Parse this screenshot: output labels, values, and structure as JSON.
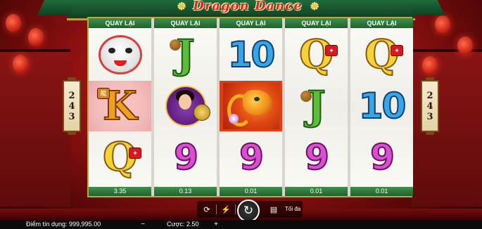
{
  "game": {
    "title": "Dragon Dance"
  },
  "ways": {
    "left": [
      "2",
      "4",
      "3"
    ],
    "right": [
      "2",
      "4",
      "3"
    ]
  },
  "reels": [
    {
      "header": "QUAY LẠI",
      "footer": "3.35",
      "symbols": [
        {
          "type": "lion",
          "icon": "lion-dance-icon",
          "highlight": false
        },
        {
          "type": "letter",
          "text": "K",
          "style": "K",
          "icon": "dragon-statue-icon",
          "highlight": true
        },
        {
          "type": "letter",
          "text": "Q",
          "style": "Q",
          "icon": "red-fan-icon",
          "highlight": false
        }
      ]
    },
    {
      "header": "QUAY LẠI",
      "footer": "0.13",
      "symbols": [
        {
          "type": "letter",
          "text": "J",
          "style": "J",
          "icon": "money-bag-icon",
          "highlight": false
        },
        {
          "type": "lady",
          "icon": "lady-gong-icon",
          "highlight": false
        },
        {
          "type": "num",
          "text": "9",
          "style": "9",
          "highlight": false
        }
      ]
    },
    {
      "header": "QUAY LẠI",
      "footer": "0.01",
      "symbols": [
        {
          "type": "num",
          "text": "10",
          "style": "10",
          "highlight": false
        },
        {
          "type": "dragon",
          "icon": "dragon-wild-icon",
          "highlight": false
        },
        {
          "type": "num",
          "text": "9",
          "style": "9",
          "highlight": false
        }
      ]
    },
    {
      "header": "QUAY LẠI",
      "footer": "0.01",
      "symbols": [
        {
          "type": "letter",
          "text": "Q",
          "style": "Q",
          "icon": "red-fan-icon",
          "highlight": false
        },
        {
          "type": "letter",
          "text": "J",
          "style": "J",
          "icon": "money-bag-icon",
          "highlight": false
        },
        {
          "type": "num",
          "text": "9",
          "style": "9",
          "highlight": false
        }
      ]
    },
    {
      "header": "QUAY LẠI",
      "footer": "0.01",
      "symbols": [
        {
          "type": "letter",
          "text": "Q",
          "style": "Q",
          "icon": "red-fan-icon",
          "highlight": false
        },
        {
          "type": "num",
          "text": "10",
          "style": "10",
          "highlight": false
        },
        {
          "type": "num",
          "text": "9",
          "style": "9",
          "highlight": false
        }
      ]
    }
  ],
  "controls": {
    "autoplay_icon": "autoplay-icon",
    "turbo_icon": "lightning-icon",
    "spin_icon": "spin-arrows-icon",
    "bet_stack_icon": "coin-stack-icon",
    "max_label": "Tối đa"
  },
  "footer": {
    "credit": "Điểm tín dụng: 999,995.00",
    "bet": "Cược: 2.50",
    "bet_decrease": "−",
    "bet_increase": "+"
  },
  "colors": {
    "reel_header": "#2f7a3c",
    "background": "#a31414",
    "frame_gold": "#c9a13a"
  }
}
